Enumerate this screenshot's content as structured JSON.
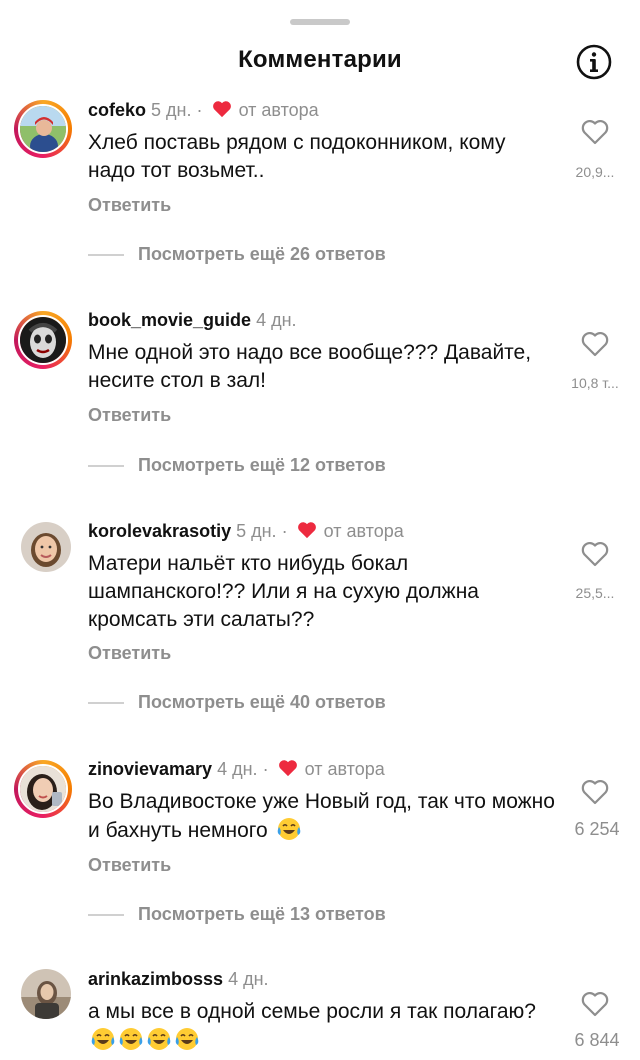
{
  "header": {
    "grabber": "drag-handle",
    "title": "Комментарии",
    "info_icon": "info-icon"
  },
  "comments": [
    {
      "user": "cofeko",
      "time": "5 дн.",
      "author_liked": true,
      "author_label": "от автора",
      "text": "Хлеб поставь рядом с подоконником, кому надо тот возьмет..",
      "reply_label": "Ответить",
      "likes": "20,9...",
      "view_replies": "Посмотреть ещё 26 ответов",
      "story_ring": true
    },
    {
      "user": "book_movie_guide",
      "time": "4 дн.",
      "author_liked": false,
      "author_label": "",
      "text": "Мне одной это надо все вообще??? Давайте, несите стол в зал!",
      "reply_label": "Ответить",
      "likes": "10,8 т...",
      "view_replies": "Посмотреть ещё 12 ответов",
      "story_ring": true
    },
    {
      "user": "korolevakrasotiy",
      "time": "5 дн.",
      "author_liked": true,
      "author_label": "от автора",
      "text": "Матери нальёт кто нибудь бокал шампанского!?? Или я на сухую должна кромсать эти салаты??",
      "reply_label": "Ответить",
      "likes": "25,5...",
      "view_replies": "Посмотреть ещё 40 ответов",
      "story_ring": false
    },
    {
      "user": "zinovievamary",
      "time": "4 дн.",
      "author_liked": true,
      "author_label": "от автора",
      "text": "Во Владивостоке уже Новый год, так что можно и бахнуть немного",
      "reply_label": "Ответить",
      "likes": "6 254",
      "view_replies": "Посмотреть ещё 13 ответов",
      "story_ring": true
    },
    {
      "user": "arinkazimbosss",
      "time": "4 дн.",
      "author_liked": false,
      "author_label": "",
      "text": "а мы все в одной семье росли я так полагаю?",
      "likes": "6 844",
      "story_ring": false
    }
  ],
  "colors": {
    "heart_red": "#ed2a3f",
    "muted_text": "#8e8e8e",
    "story_ring": [
      "#f9a825",
      "#e91e63"
    ]
  }
}
